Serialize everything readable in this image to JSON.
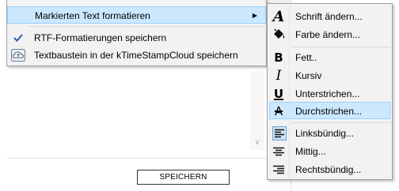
{
  "main_menu": {
    "items": [
      {
        "label": "Markierten Text formatieren",
        "icon": "none",
        "has_submenu": true
      },
      {
        "label": "RTF-Formatierungen speichern",
        "icon": "checkmark-icon"
      },
      {
        "label": "Textbaustein in der kTimeStampCloud speichern",
        "icon": "cloud-upload-icon"
      }
    ]
  },
  "submenu": {
    "items": [
      {
        "label": "Schrift ändern...",
        "icon": "font-icon"
      },
      {
        "label": "Farbe ändern...",
        "icon": "paint-bucket-icon"
      },
      {
        "label": "Fett..",
        "icon": "bold-icon"
      },
      {
        "label": "Kursiv",
        "icon": "italic-icon"
      },
      {
        "label": "Unterstrichen...",
        "icon": "underline-icon"
      },
      {
        "label": "Durchstrichen...",
        "icon": "strikethrough-icon"
      },
      {
        "label": "Linksbündig...",
        "icon": "align-left-icon"
      },
      {
        "label": "Mittig...",
        "icon": "align-center-icon"
      },
      {
        "label": "Rechtsbündig...",
        "icon": "align-right-icon"
      }
    ]
  },
  "footer": {
    "save_label": "SPEICHERN"
  },
  "colors": {
    "highlight": "#cce8ff",
    "highlight_border": "#99d1ff",
    "menu_bg": "#f2f2f2"
  }
}
